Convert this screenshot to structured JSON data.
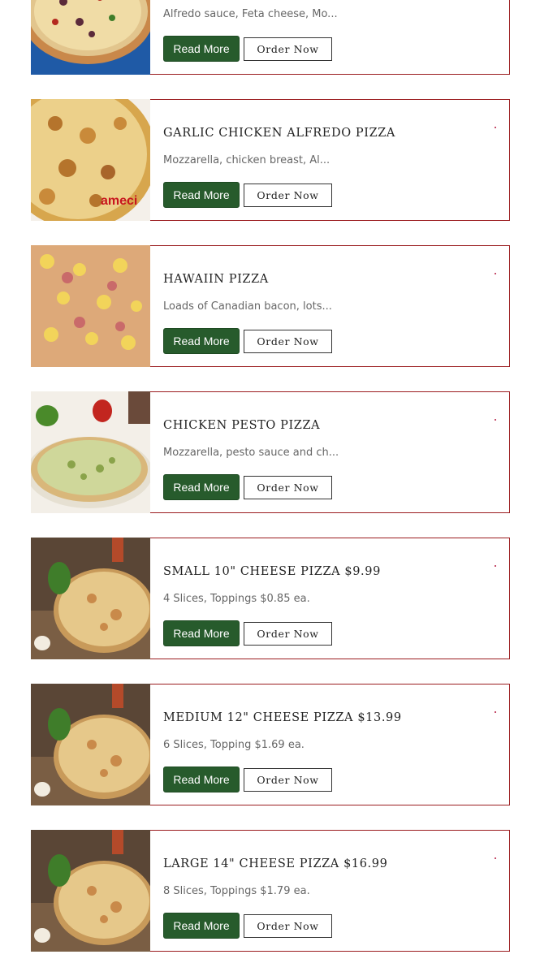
{
  "menu": {
    "items": [
      {
        "title": "",
        "description": "Alfredo sauce, Feta cheese, Mo...",
        "read_more_label": "Read More",
        "order_label": "Order Now",
        "image": "pizza-photo"
      },
      {
        "title": "GARLIC CHICKEN ALFREDO PIZZA",
        "description": "Mozzarella, chicken breast, Al...",
        "read_more_label": "Read More",
        "order_label": "Order Now",
        "image": "pizza-photo",
        "image_logo_text": "ameci"
      },
      {
        "title": "HAWAIIN PIZZA",
        "description": "Loads of Canadian bacon, lots...",
        "read_more_label": "Read More",
        "order_label": "Order Now",
        "image": "pizza-photo"
      },
      {
        "title": "CHICKEN PESTO PIZZA",
        "description": "Mozzarella, pesto sauce and ch...",
        "read_more_label": "Read More",
        "order_label": "Order Now",
        "image": "pizza-photo"
      },
      {
        "title": "SMALL 10\" CHEESE PIZZA $9.99",
        "description": "4 Slices, Toppings $0.85 ea.",
        "read_more_label": "Read More",
        "order_label": "Order Now",
        "image": "pizza-photo"
      },
      {
        "title": "MEDIUM 12\" CHEESE PIZZA $13.99",
        "description": "6 Slices, Topping $1.69 ea.",
        "read_more_label": "Read More",
        "order_label": "Order Now",
        "image": "pizza-photo"
      },
      {
        "title": "LARGE 14\" CHEESE PIZZA $16.99",
        "description": "8 Slices, Toppings $1.79 ea.",
        "read_more_label": "Read More",
        "order_label": "Order Now",
        "image": "pizza-photo"
      }
    ]
  },
  "colors": {
    "card_border": "#9b1c1f",
    "read_more_bg": "#275b2c",
    "accent_dot": "#b3163d"
  }
}
